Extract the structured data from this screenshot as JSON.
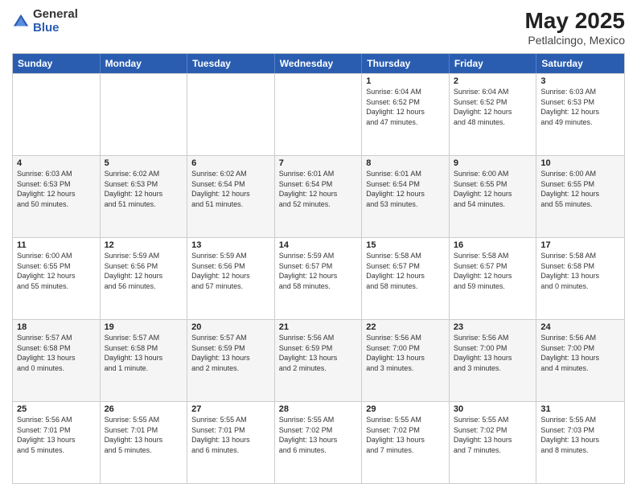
{
  "header": {
    "logo_general": "General",
    "logo_blue": "Blue",
    "title": "May 2025",
    "subtitle": "Petlalcingo, Mexico"
  },
  "days_of_week": [
    "Sunday",
    "Monday",
    "Tuesday",
    "Wednesday",
    "Thursday",
    "Friday",
    "Saturday"
  ],
  "weeks": [
    [
      {
        "day": "",
        "info": ""
      },
      {
        "day": "",
        "info": ""
      },
      {
        "day": "",
        "info": ""
      },
      {
        "day": "",
        "info": ""
      },
      {
        "day": "1",
        "info": "Sunrise: 6:04 AM\nSunset: 6:52 PM\nDaylight: 12 hours\nand 47 minutes."
      },
      {
        "day": "2",
        "info": "Sunrise: 6:04 AM\nSunset: 6:52 PM\nDaylight: 12 hours\nand 48 minutes."
      },
      {
        "day": "3",
        "info": "Sunrise: 6:03 AM\nSunset: 6:53 PM\nDaylight: 12 hours\nand 49 minutes."
      }
    ],
    [
      {
        "day": "4",
        "info": "Sunrise: 6:03 AM\nSunset: 6:53 PM\nDaylight: 12 hours\nand 50 minutes."
      },
      {
        "day": "5",
        "info": "Sunrise: 6:02 AM\nSunset: 6:53 PM\nDaylight: 12 hours\nand 51 minutes."
      },
      {
        "day": "6",
        "info": "Sunrise: 6:02 AM\nSunset: 6:54 PM\nDaylight: 12 hours\nand 51 minutes."
      },
      {
        "day": "7",
        "info": "Sunrise: 6:01 AM\nSunset: 6:54 PM\nDaylight: 12 hours\nand 52 minutes."
      },
      {
        "day": "8",
        "info": "Sunrise: 6:01 AM\nSunset: 6:54 PM\nDaylight: 12 hours\nand 53 minutes."
      },
      {
        "day": "9",
        "info": "Sunrise: 6:00 AM\nSunset: 6:55 PM\nDaylight: 12 hours\nand 54 minutes."
      },
      {
        "day": "10",
        "info": "Sunrise: 6:00 AM\nSunset: 6:55 PM\nDaylight: 12 hours\nand 55 minutes."
      }
    ],
    [
      {
        "day": "11",
        "info": "Sunrise: 6:00 AM\nSunset: 6:55 PM\nDaylight: 12 hours\nand 55 minutes."
      },
      {
        "day": "12",
        "info": "Sunrise: 5:59 AM\nSunset: 6:56 PM\nDaylight: 12 hours\nand 56 minutes."
      },
      {
        "day": "13",
        "info": "Sunrise: 5:59 AM\nSunset: 6:56 PM\nDaylight: 12 hours\nand 57 minutes."
      },
      {
        "day": "14",
        "info": "Sunrise: 5:59 AM\nSunset: 6:57 PM\nDaylight: 12 hours\nand 58 minutes."
      },
      {
        "day": "15",
        "info": "Sunrise: 5:58 AM\nSunset: 6:57 PM\nDaylight: 12 hours\nand 58 minutes."
      },
      {
        "day": "16",
        "info": "Sunrise: 5:58 AM\nSunset: 6:57 PM\nDaylight: 12 hours\nand 59 minutes."
      },
      {
        "day": "17",
        "info": "Sunrise: 5:58 AM\nSunset: 6:58 PM\nDaylight: 13 hours\nand 0 minutes."
      }
    ],
    [
      {
        "day": "18",
        "info": "Sunrise: 5:57 AM\nSunset: 6:58 PM\nDaylight: 13 hours\nand 0 minutes."
      },
      {
        "day": "19",
        "info": "Sunrise: 5:57 AM\nSunset: 6:58 PM\nDaylight: 13 hours\nand 1 minute."
      },
      {
        "day": "20",
        "info": "Sunrise: 5:57 AM\nSunset: 6:59 PM\nDaylight: 13 hours\nand 2 minutes."
      },
      {
        "day": "21",
        "info": "Sunrise: 5:56 AM\nSunset: 6:59 PM\nDaylight: 13 hours\nand 2 minutes."
      },
      {
        "day": "22",
        "info": "Sunrise: 5:56 AM\nSunset: 7:00 PM\nDaylight: 13 hours\nand 3 minutes."
      },
      {
        "day": "23",
        "info": "Sunrise: 5:56 AM\nSunset: 7:00 PM\nDaylight: 13 hours\nand 3 minutes."
      },
      {
        "day": "24",
        "info": "Sunrise: 5:56 AM\nSunset: 7:00 PM\nDaylight: 13 hours\nand 4 minutes."
      }
    ],
    [
      {
        "day": "25",
        "info": "Sunrise: 5:56 AM\nSunset: 7:01 PM\nDaylight: 13 hours\nand 5 minutes."
      },
      {
        "day": "26",
        "info": "Sunrise: 5:55 AM\nSunset: 7:01 PM\nDaylight: 13 hours\nand 5 minutes."
      },
      {
        "day": "27",
        "info": "Sunrise: 5:55 AM\nSunset: 7:01 PM\nDaylight: 13 hours\nand 6 minutes."
      },
      {
        "day": "28",
        "info": "Sunrise: 5:55 AM\nSunset: 7:02 PM\nDaylight: 13 hours\nand 6 minutes."
      },
      {
        "day": "29",
        "info": "Sunrise: 5:55 AM\nSunset: 7:02 PM\nDaylight: 13 hours\nand 7 minutes."
      },
      {
        "day": "30",
        "info": "Sunrise: 5:55 AM\nSunset: 7:02 PM\nDaylight: 13 hours\nand 7 minutes."
      },
      {
        "day": "31",
        "info": "Sunrise: 5:55 AM\nSunset: 7:03 PM\nDaylight: 13 hours\nand 8 minutes."
      }
    ]
  ]
}
